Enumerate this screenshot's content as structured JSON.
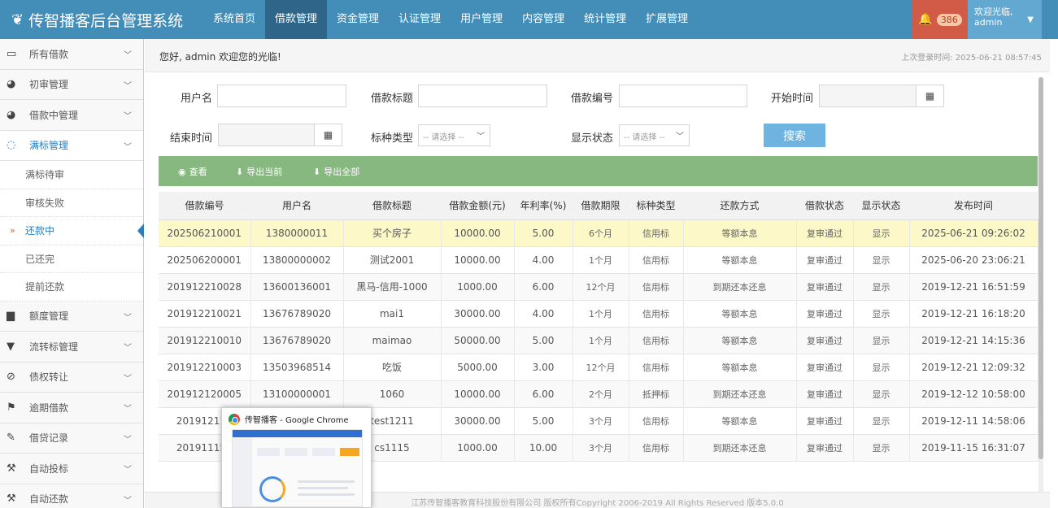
{
  "brand": {
    "title": "传智播客后台管理系统",
    "icon": "leaf-icon"
  },
  "topnav": [
    {
      "label": "系统首页",
      "active": false
    },
    {
      "label": "借款管理",
      "active": true
    },
    {
      "label": "资金管理",
      "active": false
    },
    {
      "label": "认证管理",
      "active": false
    },
    {
      "label": "用户管理",
      "active": false
    },
    {
      "label": "内容管理",
      "active": false
    },
    {
      "label": "统计管理",
      "active": false
    },
    {
      "label": "扩展管理",
      "active": false
    }
  ],
  "notifications": {
    "count": "386"
  },
  "user": {
    "welcome": "欢迎光临,",
    "name": "admin"
  },
  "sidebar": {
    "items": [
      {
        "label": "所有借款",
        "icon": "desktop-icon"
      },
      {
        "label": "初审管理",
        "icon": "dashboard-icon"
      },
      {
        "label": "借款中管理",
        "icon": "dashboard-icon"
      },
      {
        "label": "满标管理",
        "icon": "comment-icon"
      }
    ],
    "subitems": [
      {
        "label": "满标待审"
      },
      {
        "label": "审核失败"
      },
      {
        "label": "还款中"
      },
      {
        "label": "已还完"
      },
      {
        "label": "提前还款"
      }
    ],
    "items2": [
      {
        "label": "额度管理",
        "icon": "folder-icon"
      },
      {
        "label": "流转标管理",
        "icon": "filter-icon"
      },
      {
        "label": "债权转让",
        "icon": "eye-slash-icon"
      },
      {
        "label": "逾期借款",
        "icon": "flag-icon"
      },
      {
        "label": "借贷记录",
        "icon": "edit-icon"
      },
      {
        "label": "自动投标",
        "icon": "gavel-icon"
      },
      {
        "label": "自动还款",
        "icon": "gavel-icon"
      }
    ]
  },
  "breadcrumb": {
    "greeting": "您好,   admin  欢迎您的光临!",
    "last_login": "上次登录时间: 2025-06-21 08:57:45"
  },
  "form": {
    "username_label": "用户名",
    "title_label": "借款标题",
    "loan_no_label": "借款编号",
    "start_label": "开始时间",
    "end_label": "结束时间",
    "type_label": "标种类型",
    "type_value": "-- 请选择 --",
    "status_label": "显示状态",
    "status_value": "-- 请选择 --",
    "search_button": "搜索"
  },
  "toolbar": {
    "view": "查看",
    "export_current": "导出当前",
    "export_all": "导出全部"
  },
  "table": {
    "headers": [
      "借款编号",
      "用户名",
      "借款标题",
      "借款金额(元)",
      "年利率(%)",
      "借款期限",
      "标种类型",
      "还款方式",
      "借款状态",
      "显示状态",
      "发布时间"
    ],
    "rows": [
      [
        "202506210001",
        "1380000011",
        "买个房子",
        "10000.00",
        "5.00",
        "6个月",
        "信用标",
        "等额本息",
        "复审通过",
        "显示",
        "2025-06-21 09:26:02"
      ],
      [
        "202506200001",
        "13800000002",
        "测试2001",
        "10000.00",
        "4.00",
        "1个月",
        "信用标",
        "等额本息",
        "复审通过",
        "显示",
        "2025-06-20 23:06:21"
      ],
      [
        "201912210028",
        "13600136001",
        "黑马-信用-1000",
        "1000.00",
        "6.00",
        "12个月",
        "信用标",
        "到期还本还息",
        "复审通过",
        "显示",
        "2019-12-21 16:51:59"
      ],
      [
        "201912210021",
        "13676789020",
        "mai1",
        "30000.00",
        "4.00",
        "1个月",
        "信用标",
        "等额本息",
        "复审通过",
        "显示",
        "2019-12-21 16:18:20"
      ],
      [
        "201912210010",
        "13676789020",
        "maimao",
        "50000.00",
        "5.00",
        "1个月",
        "信用标",
        "等额本息",
        "复审通过",
        "显示",
        "2019-12-21 14:15:36"
      ],
      [
        "201912210003",
        "13503968514",
        "吃饭",
        "5000.00",
        "3.00",
        "12个月",
        "信用标",
        "等额本息",
        "复审通过",
        "显示",
        "2019-12-21 12:09:32"
      ],
      [
        "201912120005",
        "13100000001",
        "1060",
        "10000.00",
        "6.00",
        "2个月",
        "抵押标",
        "到期还本还息",
        "复审通过",
        "显示",
        "2019-12-12 10:58:00"
      ],
      [
        "201912110",
        "",
        "test1211",
        "30000.00",
        "5.00",
        "3个月",
        "信用标",
        "等额本息",
        "复审通过",
        "显示",
        "2019-12-11 14:58:06"
      ],
      [
        "201911150",
        "",
        "cs1115",
        "1000.00",
        "10.00",
        "3个月",
        "信用标",
        "到期还本还息",
        "复审通过",
        "显示",
        "2019-11-15 16:31:07"
      ]
    ]
  },
  "footer": {
    "text": "江苏传智播客教育科技股份有限公司 版权所有Copyright 2006-2019 All Rights Reserved 版本5.0.0"
  },
  "preview": {
    "title": "传智播客 - Google Chrome"
  },
  "colors": {
    "navbar": "#438eb9",
    "active_nav": "#2e6589",
    "toolbar": "#87b87f",
    "selected_row": "#fcf8c7",
    "search_button": "#6fb3e0"
  }
}
